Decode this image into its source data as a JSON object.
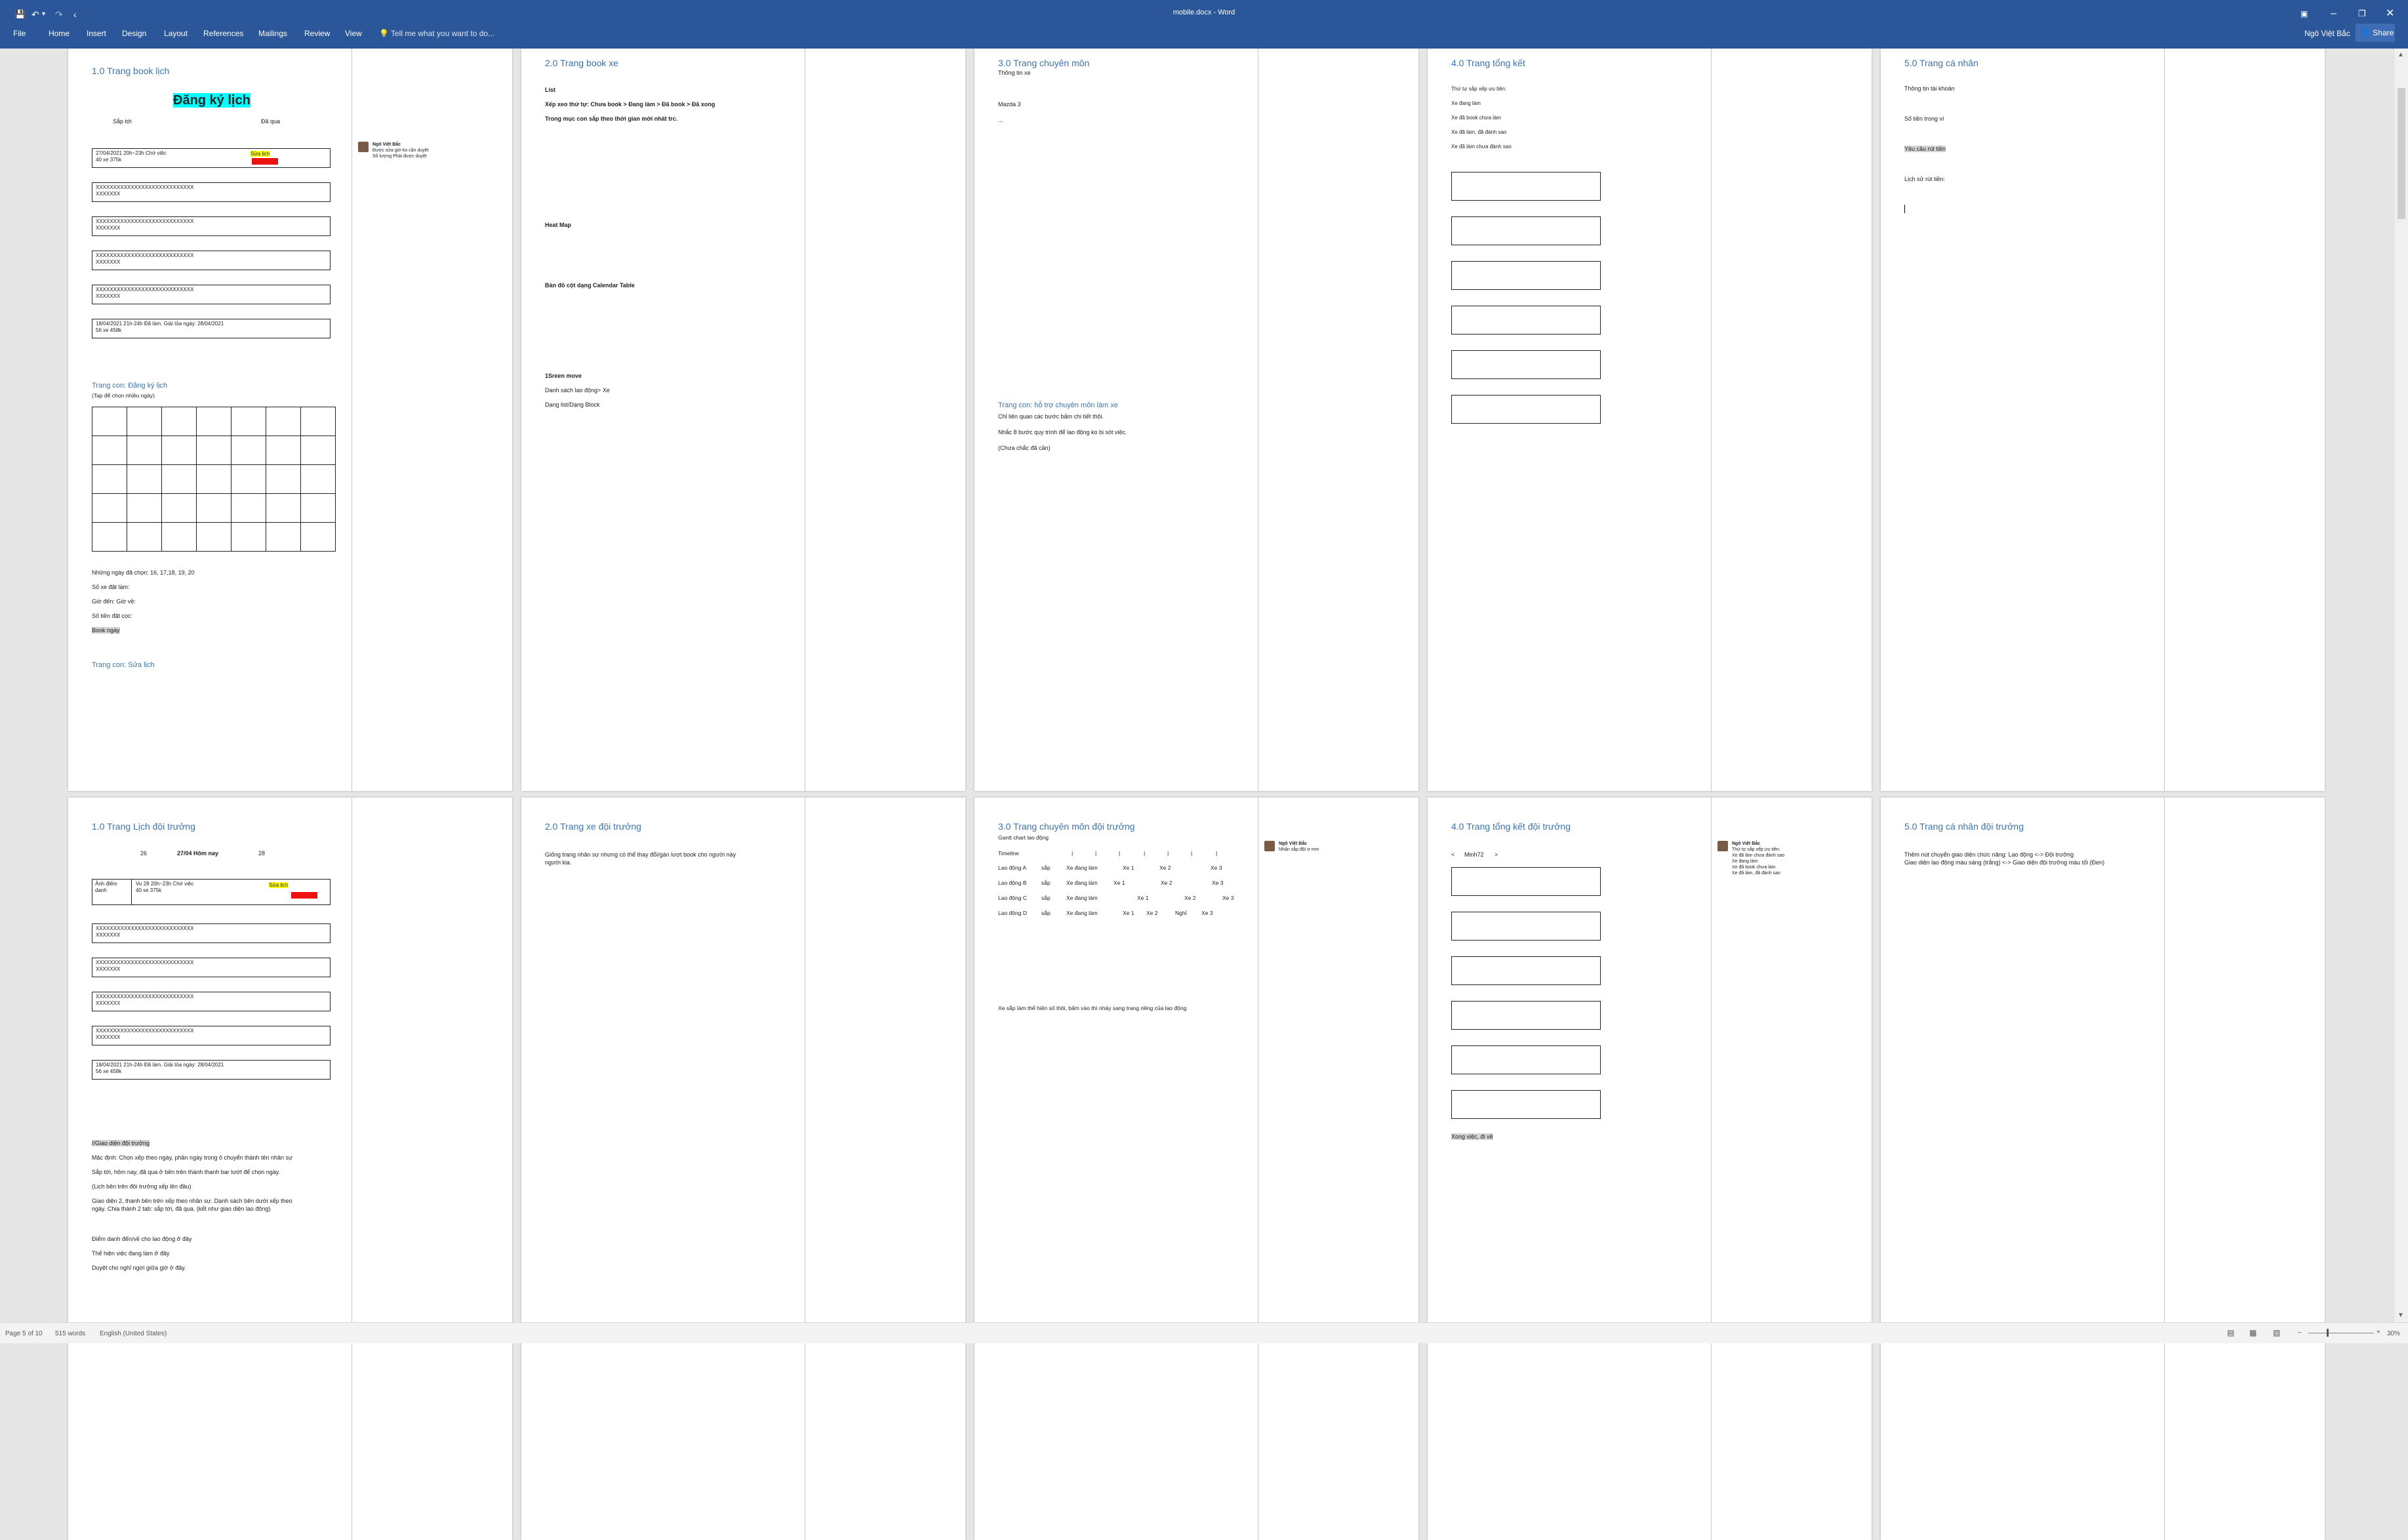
{
  "window": {
    "title": "mobile.docx - Word",
    "user": "Ngô Việt Bắc",
    "share": "Share",
    "min_icon": "minimize-icon",
    "max_icon": "restore-icon",
    "close_icon": "close-icon"
  },
  "quick_access": {
    "save": "💾",
    "undo": "↶",
    "undo_caret": "▾",
    "redo": "↷",
    "more": "‹"
  },
  "menu": [
    "File",
    "Home",
    "Insert",
    "Design",
    "Layout",
    "References",
    "Mailings",
    "Review",
    "View"
  ],
  "tell_me": "Tell me what you want to do...",
  "status": {
    "page": "Page 5 of 10",
    "words": "515 words",
    "language": "English (United States)",
    "zoom": "30%"
  },
  "pages": {
    "p1": {
      "heading": "1.0 Trang book lịch",
      "title": "Đăng ký lịch",
      "tab_left": "Sắp tới",
      "tab_right": "Đã qua",
      "card1_a": "27/04/2021  20h~23h   Chờ việc",
      "card1_b": "40 xe  375k",
      "card1_edit": "Sửa lịch",
      "card_x1": "XXXXXXXXXXXXXXXXXXXXXXXXXXXX",
      "card_x2": "XXXXXXX",
      "card6_a": "18/04/2021   21h-24h  Đã làm. Giải tỏa ngày: 28/04/2021",
      "card6_b": "56 xe 458k",
      "sub1": "Trang con: Đăng ký lịch",
      "sub1_note": "(Tap để chọn nhiều ngày)",
      "chosen": "Những ngày đã chọn: 16, 17,18, 19, 20",
      "cars": "Số xe đặt làm:",
      "time": "Giờ đến:       Giờ về:",
      "deposit": "Số tiền đặt cọc:",
      "book": "Book ngày",
      "sub2": "Trang con: Sửa lịch",
      "cmt_name": "Ngô Việt Bắc",
      "cmt_l1": "Được sửa giờ ko cần duyệt",
      "cmt_l2": "Số lượng Phải được duyệt"
    },
    "p2": {
      "heading": "2.0 Trang book xe",
      "l1": "List",
      "l2": "Xếp xeo thứ tự: Chưa book > Đang làm > Đã book > Đã xong",
      "l3": "Trong mục con sắp theo thời gian mới nhất trc.",
      "l4": "Heat Map",
      "l5": "Bản đồ cột dạng Calendar Table",
      "l6": "1Sreen move",
      "l7": "Danh sách lao động> Xe",
      "l8": "Dạng list/Dạng Block"
    },
    "p3": {
      "heading": "3.0 Trang chuyên môn",
      "l1": "Thông tin xe",
      "l2": "Mazda 3",
      "l3": "...",
      "sub": "Trang con: hỗ trợ chuyên môn làm xe",
      "l4": "Chỉ liên quan các bước bấm chi tiết thôi.",
      "l5": "Nhắc 8 bước quy trình để lao động ko bị sót việc.",
      "l6": "(Chưa chắc đã cần)"
    },
    "p4": {
      "heading": "4.0 Trang tổng kết",
      "l1": "Thứ tự sắp xếp ưu tiên:",
      "l2": "Xe đang làm",
      "l3": "Xe đã book chưa làm",
      "l4": "Xe đã làm, đã đánh sao",
      "l5": "Xe đã làm chưa đánh sao"
    },
    "p5": {
      "heading": "5.0 Trang cá nhân",
      "l1": "Thông tin tài khoản",
      "l2": "Số tiền trong ví",
      "l3": "Yêu cầu rút tiền",
      "l4": "Lịch sử rút tiền:"
    },
    "p6": {
      "heading": "1.0 Trang Lịch đội trưởng",
      "d1": "26",
      "d2": "27/04 Hôm nay",
      "d3": "28",
      "c1_l1": "Ảnh điểm",
      "c1_l2": "danh",
      "c1_a": "Vu 28  20h~23h   Chờ việc",
      "c1_b": "40 xe  375k",
      "c1_edit": "Sửa lịch",
      "card_x1": "XXXXXXXXXXXXXXXXXXXXXXXXXXXX",
      "card_x2": "XXXXXXX",
      "card6_a": "18/04/2021   21h-24h  Đã làm. Giải tỏa ngày: 28/04/2021",
      "card6_b": "56 xe 458k",
      "g1": "//Giao diện đội trưởng",
      "g2": "Mặc định: Chọn xếp theo ngày, phần ngày trong ô chuyển thành tên nhân sự",
      "g3": "Sắp tới, hôm nay, đã qua ở bên trên thành thanh bar lướt để chọn ngày.",
      "g4": "(Lịch bên trên đội trưởng xếp lên đầu)",
      "g5": "Giao diện 2, thanh bên trên xếp theo nhân sự. Danh sách bên dưới xếp theo",
      "g6": "ngày. Chia thành 2 tab: sắp tới, đã qua. (kết như giao diện lao động)",
      "g7": "Điểm danh đến/về cho lao động ở đây",
      "g8": "Thể hiện việc đang làm ở đây",
      "g9": "Duyệt cho nghỉ ngơi giữa giờ ở đây."
    },
    "p7": {
      "heading": "2.0 Trang xe đội trưởng",
      "l1": "Giống trang nhân sự nhưng có thể thay đổi/gán lượt book cho người này",
      "l2": "người kia."
    },
    "p8": {
      "heading": "3.0 Trang chuyên môn đội trưởng",
      "l1": "Gantt chart lao động",
      "timeline": "Timeline",
      "tick": "|",
      "rows": [
        {
          "name": "Lao động A",
          "c": [
            "sắp",
            "Xe đang làm",
            "Xe 1",
            "Xe 2",
            "",
            "Xe 3"
          ]
        },
        {
          "name": "Lao động B",
          "c": [
            "sắp",
            "Xe đang làm",
            "Xe 1",
            "Xe 2",
            "",
            "Xe 3"
          ]
        },
        {
          "name": "Lao động C",
          "c": [
            "sắp",
            "Xe đang làm",
            "Xe 1",
            "Xe 2",
            "",
            "Xe 3"
          ]
        },
        {
          "name": "Lao động D",
          "c": [
            "sắp",
            "Xe đang làm",
            "Xe 1",
            "Xe 2",
            "Nghỉ",
            "Xe 3"
          ]
        }
      ],
      "l2": "Xe sắp làm thể hiện số thôi, bấm vào thì nhảy sang trang riêng của lao động",
      "cmt_name": "Ngô Việt Bắc",
      "cmt_l1": "Nhấn sắp đội ơ mm"
    },
    "p9": {
      "heading": "4.0 Trang tổng kết đội trưởng",
      "nav_prev": "<",
      "nav_label": "Minh72",
      "nav_next": ">",
      "foot": "Xong việc, đi về",
      "cmt_name": "Ngô Việt Bắc",
      "cmt_l1": "Thứ tự sắp xếp ưu tiên:",
      "cmt_l2": "Xe đã làm chưa đánh sao",
      "cmt_l3": "Xe đang làm",
      "cmt_l4": "Xe đã book chưa làm",
      "cmt_l5": "Xe đã làm, đã đánh sao"
    },
    "p10": {
      "heading": "5.0 Trang cá nhân đội trưởng",
      "l1": "Thêm nút chuyển giao diện chức năng: Lao động <-> Đội trưởng",
      "l2": "Giao diện lao động màu sáng (trắng) <-> Giao diện đội trưởng màu tối (Đen)"
    }
  }
}
